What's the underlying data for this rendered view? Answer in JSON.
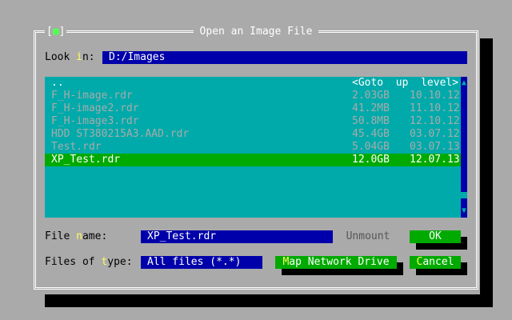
{
  "dialog": {
    "title": "Open an Image File",
    "close_box": "[",
    "close_dot": "■",
    "close_box_end": "]"
  },
  "look_in": {
    "label_pre": "Look ",
    "label_hot": "i",
    "label_post": "n:",
    "value": "D:/Images"
  },
  "files": {
    "up_text": "..",
    "up_label": "<Goto  up  level>",
    "rows": [
      {
        "name": "F_H-image.rdr",
        "size": "2.03GB",
        "date": "10.10.12"
      },
      {
        "name": "F_H-image2.rdr",
        "size": "41.2MB",
        "date": "11.10.12"
      },
      {
        "name": "F_H-image3.rdr",
        "size": "50.8MB",
        "date": "12.10.12"
      },
      {
        "name": "HDD ST380215A3.AAD.rdr",
        "size": "45.4GB",
        "date": "03.07.12"
      },
      {
        "name": "Test.rdr",
        "size": "5.04GB",
        "date": "03.07.13"
      },
      {
        "name": "XP_Test.rdr",
        "size": "12.0GB",
        "date": "12.07.13"
      }
    ],
    "selected_index": 5,
    "scroll_up": "▲",
    "scroll_down": "▼"
  },
  "file_name": {
    "label_pre": "File ",
    "label_hot": "n",
    "label_post": "ame:",
    "value": "XP_Test.rdr"
  },
  "file_type": {
    "label_pre": "Files of ",
    "label_hot": "t",
    "label_post": "ype:",
    "value": "All files (*.*)"
  },
  "buttons": {
    "unmount": "Unmount",
    "ok": "OK",
    "map_hot": "M",
    "map_rest": "ap Network Drive",
    "cancel_hot": "C",
    "cancel_rest": "ancel"
  },
  "colors": {
    "desktop": "#aaaaaa",
    "field_bg": "#0000aa",
    "list_bg": "#00aaaa",
    "selection": "#00aa00",
    "hotkey": "#ffff55"
  }
}
